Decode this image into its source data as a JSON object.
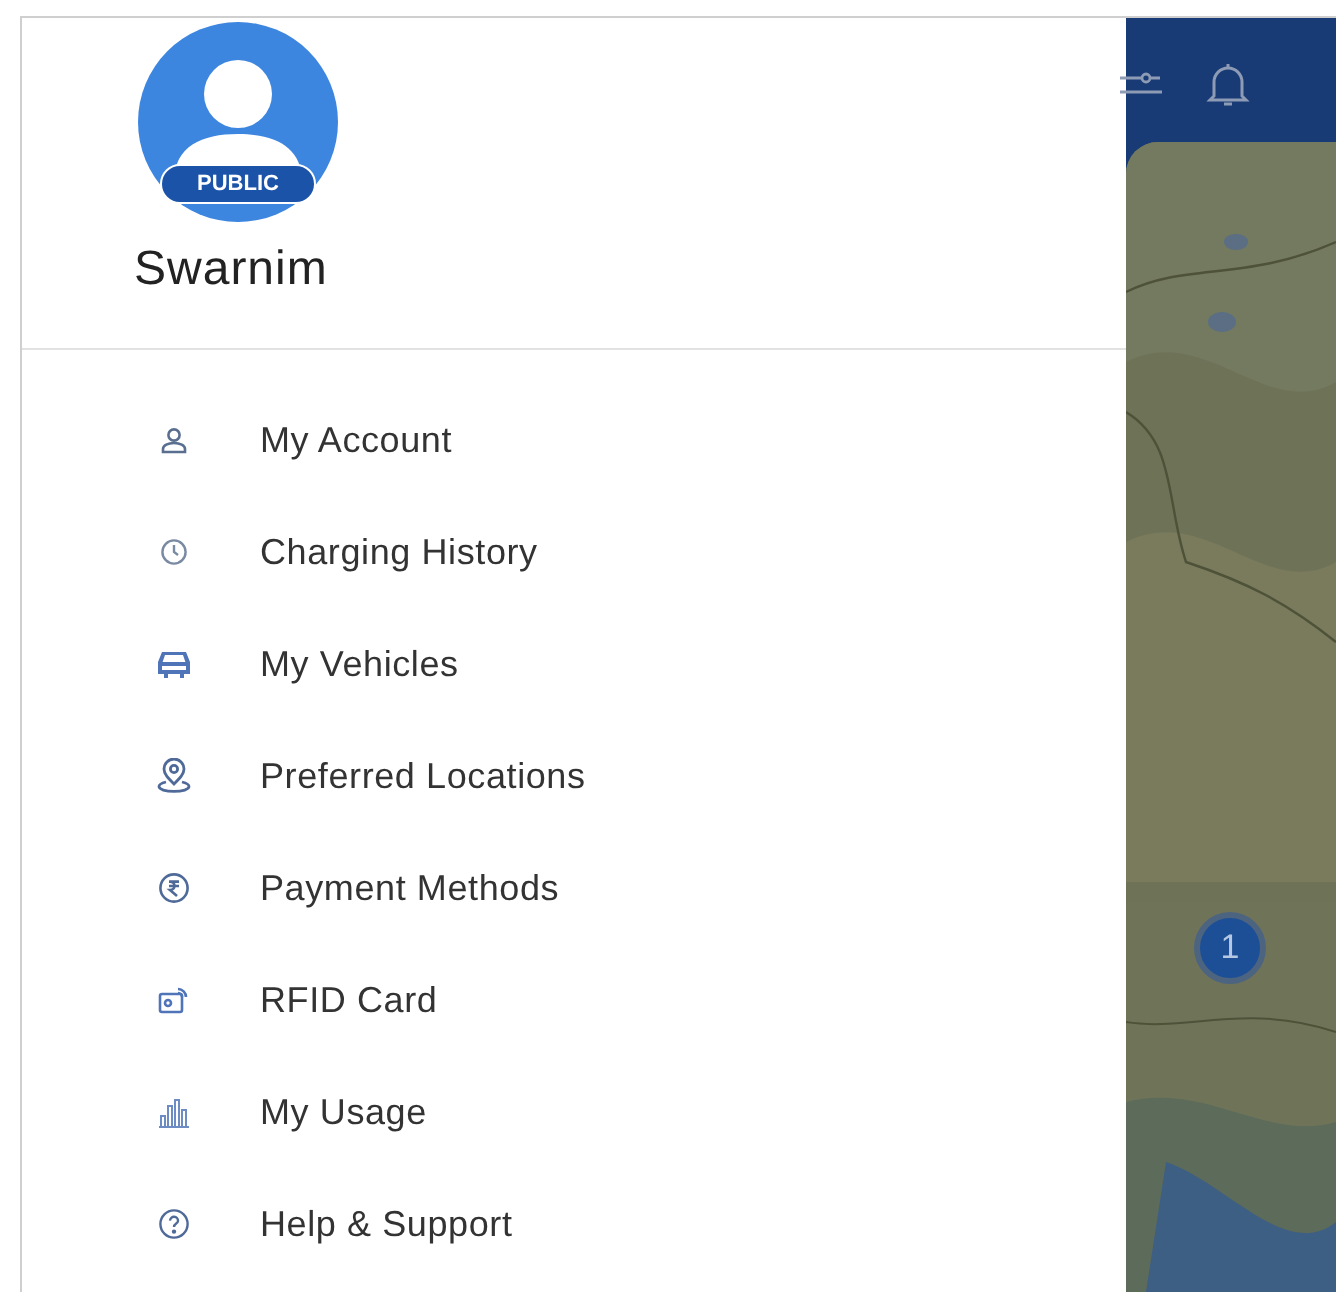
{
  "profile": {
    "badge": "PUBLIC",
    "name": "Swarnim"
  },
  "menu": [
    {
      "kind": "account",
      "label": "My Account"
    },
    {
      "kind": "history",
      "label": "Charging History"
    },
    {
      "kind": "vehicle",
      "label": "My Vehicles"
    },
    {
      "kind": "location",
      "label": "Preferred Locations"
    },
    {
      "kind": "payment",
      "label": "Payment Methods"
    },
    {
      "kind": "rfid",
      "label": "RFID Card"
    },
    {
      "kind": "usage",
      "label": "My Usage"
    },
    {
      "kind": "help",
      "label": "Help & Support"
    }
  ],
  "map": {
    "cluster_count": "1"
  }
}
